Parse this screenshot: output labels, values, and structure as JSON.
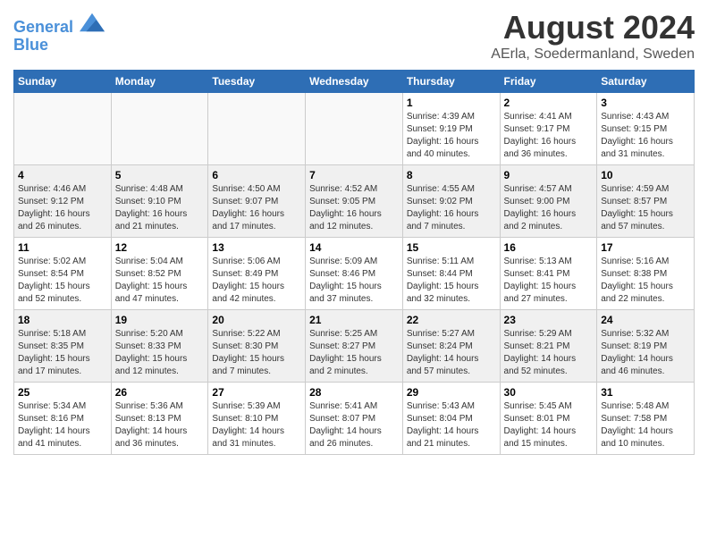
{
  "logo": {
    "line1": "General",
    "line2": "Blue"
  },
  "title": "August 2024",
  "subtitle": "AErla, Soedermanland, Sweden",
  "days_of_week": [
    "Sunday",
    "Monday",
    "Tuesday",
    "Wednesday",
    "Thursday",
    "Friday",
    "Saturday"
  ],
  "weeks": [
    [
      {
        "day": "",
        "info": ""
      },
      {
        "day": "",
        "info": ""
      },
      {
        "day": "",
        "info": ""
      },
      {
        "day": "",
        "info": ""
      },
      {
        "day": "1",
        "info": "Sunrise: 4:39 AM\nSunset: 9:19 PM\nDaylight: 16 hours\nand 40 minutes."
      },
      {
        "day": "2",
        "info": "Sunrise: 4:41 AM\nSunset: 9:17 PM\nDaylight: 16 hours\nand 36 minutes."
      },
      {
        "day": "3",
        "info": "Sunrise: 4:43 AM\nSunset: 9:15 PM\nDaylight: 16 hours\nand 31 minutes."
      }
    ],
    [
      {
        "day": "4",
        "info": "Sunrise: 4:46 AM\nSunset: 9:12 PM\nDaylight: 16 hours\nand 26 minutes."
      },
      {
        "day": "5",
        "info": "Sunrise: 4:48 AM\nSunset: 9:10 PM\nDaylight: 16 hours\nand 21 minutes."
      },
      {
        "day": "6",
        "info": "Sunrise: 4:50 AM\nSunset: 9:07 PM\nDaylight: 16 hours\nand 17 minutes."
      },
      {
        "day": "7",
        "info": "Sunrise: 4:52 AM\nSunset: 9:05 PM\nDaylight: 16 hours\nand 12 minutes."
      },
      {
        "day": "8",
        "info": "Sunrise: 4:55 AM\nSunset: 9:02 PM\nDaylight: 16 hours\nand 7 minutes."
      },
      {
        "day": "9",
        "info": "Sunrise: 4:57 AM\nSunset: 9:00 PM\nDaylight: 16 hours\nand 2 minutes."
      },
      {
        "day": "10",
        "info": "Sunrise: 4:59 AM\nSunset: 8:57 PM\nDaylight: 15 hours\nand 57 minutes."
      }
    ],
    [
      {
        "day": "11",
        "info": "Sunrise: 5:02 AM\nSunset: 8:54 PM\nDaylight: 15 hours\nand 52 minutes."
      },
      {
        "day": "12",
        "info": "Sunrise: 5:04 AM\nSunset: 8:52 PM\nDaylight: 15 hours\nand 47 minutes."
      },
      {
        "day": "13",
        "info": "Sunrise: 5:06 AM\nSunset: 8:49 PM\nDaylight: 15 hours\nand 42 minutes."
      },
      {
        "day": "14",
        "info": "Sunrise: 5:09 AM\nSunset: 8:46 PM\nDaylight: 15 hours\nand 37 minutes."
      },
      {
        "day": "15",
        "info": "Sunrise: 5:11 AM\nSunset: 8:44 PM\nDaylight: 15 hours\nand 32 minutes."
      },
      {
        "day": "16",
        "info": "Sunrise: 5:13 AM\nSunset: 8:41 PM\nDaylight: 15 hours\nand 27 minutes."
      },
      {
        "day": "17",
        "info": "Sunrise: 5:16 AM\nSunset: 8:38 PM\nDaylight: 15 hours\nand 22 minutes."
      }
    ],
    [
      {
        "day": "18",
        "info": "Sunrise: 5:18 AM\nSunset: 8:35 PM\nDaylight: 15 hours\nand 17 minutes."
      },
      {
        "day": "19",
        "info": "Sunrise: 5:20 AM\nSunset: 8:33 PM\nDaylight: 15 hours\nand 12 minutes."
      },
      {
        "day": "20",
        "info": "Sunrise: 5:22 AM\nSunset: 8:30 PM\nDaylight: 15 hours\nand 7 minutes."
      },
      {
        "day": "21",
        "info": "Sunrise: 5:25 AM\nSunset: 8:27 PM\nDaylight: 15 hours\nand 2 minutes."
      },
      {
        "day": "22",
        "info": "Sunrise: 5:27 AM\nSunset: 8:24 PM\nDaylight: 14 hours\nand 57 minutes."
      },
      {
        "day": "23",
        "info": "Sunrise: 5:29 AM\nSunset: 8:21 PM\nDaylight: 14 hours\nand 52 minutes."
      },
      {
        "day": "24",
        "info": "Sunrise: 5:32 AM\nSunset: 8:19 PM\nDaylight: 14 hours\nand 46 minutes."
      }
    ],
    [
      {
        "day": "25",
        "info": "Sunrise: 5:34 AM\nSunset: 8:16 PM\nDaylight: 14 hours\nand 41 minutes."
      },
      {
        "day": "26",
        "info": "Sunrise: 5:36 AM\nSunset: 8:13 PM\nDaylight: 14 hours\nand 36 minutes."
      },
      {
        "day": "27",
        "info": "Sunrise: 5:39 AM\nSunset: 8:10 PM\nDaylight: 14 hours\nand 31 minutes."
      },
      {
        "day": "28",
        "info": "Sunrise: 5:41 AM\nSunset: 8:07 PM\nDaylight: 14 hours\nand 26 minutes."
      },
      {
        "day": "29",
        "info": "Sunrise: 5:43 AM\nSunset: 8:04 PM\nDaylight: 14 hours\nand 21 minutes."
      },
      {
        "day": "30",
        "info": "Sunrise: 5:45 AM\nSunset: 8:01 PM\nDaylight: 14 hours\nand 15 minutes."
      },
      {
        "day": "31",
        "info": "Sunrise: 5:48 AM\nSunset: 7:58 PM\nDaylight: 14 hours\nand 10 minutes."
      }
    ]
  ]
}
